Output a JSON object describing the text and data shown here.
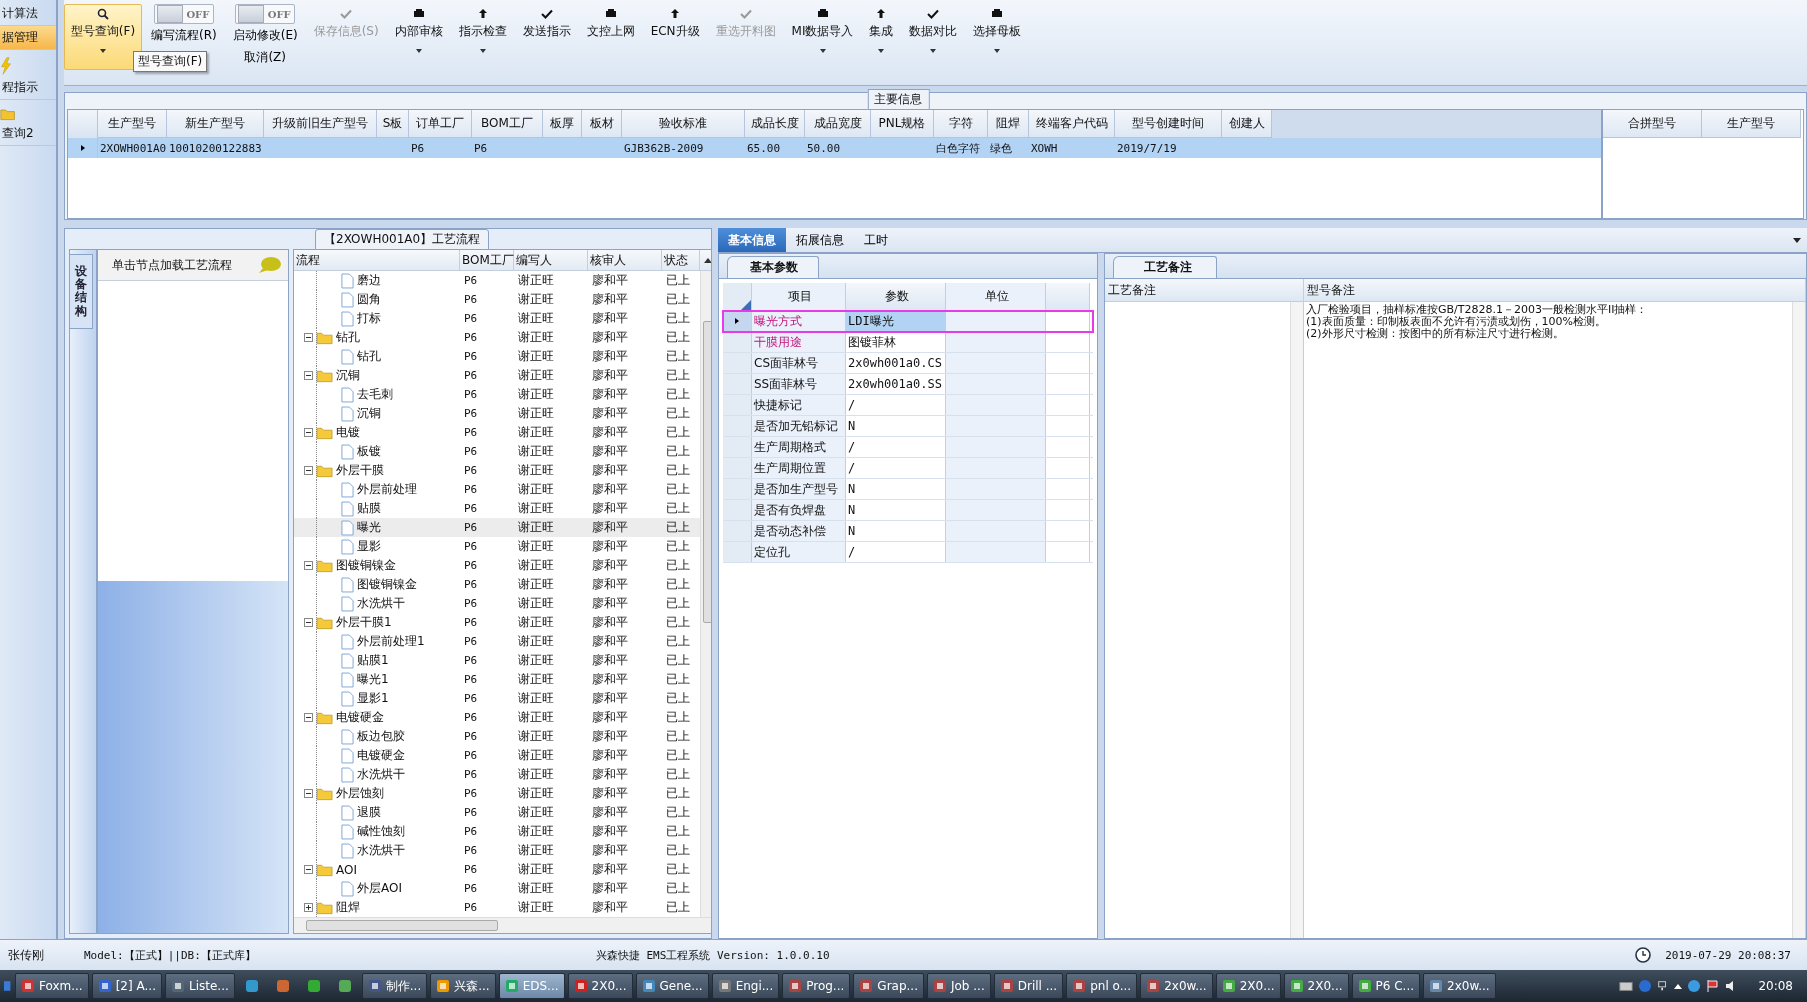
{
  "sidebar": {
    "items": [
      {
        "label": "计算法",
        "kind": "text",
        "selected": false
      },
      {
        "label": "据管理",
        "kind": "text",
        "selected": true
      },
      {
        "label": "程指示",
        "kind": "launcher",
        "selected": false
      },
      {
        "label": "查询2",
        "kind": "launcher",
        "selected": false
      }
    ]
  },
  "toolbar": {
    "buttons": [
      {
        "kind": "big",
        "label": "型号查询(F)",
        "selected": true,
        "dropdown": true
      },
      {
        "kind": "toggle",
        "switch_text": "OFF",
        "on": false,
        "label": "编写流程(R)"
      },
      {
        "kind": "toggle",
        "switch_text": "OFF",
        "on": false,
        "label": "启动修改(E)",
        "sub_label": "取消(Z)"
      },
      {
        "kind": "command",
        "label": "保存信息(S)",
        "disabled": true,
        "dropdown": false
      },
      {
        "kind": "command",
        "label": "内部审核",
        "disabled": false,
        "dropdown": true
      },
      {
        "kind": "command",
        "label": "指示检查",
        "disabled": false,
        "dropdown": true
      },
      {
        "kind": "command",
        "label": "发送指示",
        "disabled": false,
        "dropdown": false
      },
      {
        "kind": "command",
        "label": "文控上网",
        "disabled": false,
        "dropdown": false
      },
      {
        "kind": "command",
        "label": "ECN升级",
        "disabled": false,
        "dropdown": false
      },
      {
        "kind": "command",
        "label": "重选开料图",
        "disabled": true,
        "dropdown": false
      },
      {
        "kind": "command",
        "label": "MI数据导入",
        "disabled": false,
        "dropdown": true
      },
      {
        "kind": "command",
        "label": "集成",
        "disabled": false,
        "dropdown": true
      },
      {
        "kind": "command",
        "label": "数据对比",
        "disabled": false,
        "dropdown": true
      },
      {
        "kind": "command",
        "label": "选择母板",
        "disabled": false,
        "dropdown": true
      }
    ],
    "tooltip": "型号查询(F)"
  },
  "main_info": {
    "title": "主要信息",
    "columns": [
      "生产型号",
      "新生产型号",
      "升级前旧生产型号",
      "S板",
      "订单工厂",
      "BOM工厂",
      "板厚",
      "板材",
      "验收标准",
      "成品长度",
      "成品宽度",
      "PNL规格",
      "字符",
      "阻焊",
      "终端客户代码",
      "型号创建时间",
      "创建人"
    ],
    "rows": [
      {
        "selected": true,
        "cells": [
          "2XOWH001A0",
          "10010200122883",
          "",
          "",
          "P6",
          "P6",
          "",
          "",
          "GJB362B-2009",
          "65.00",
          "50.00",
          "",
          "白色字符",
          "绿色",
          "XOWH",
          "2019/7/19",
          ""
        ]
      }
    ],
    "merge_table": {
      "columns": [
        "合拼型号",
        "生产型号"
      ]
    }
  },
  "flow_panel": {
    "title": "【2XOWH001A0】工艺流程",
    "side_tab": "设备结构",
    "hint": "单击节点加载工艺流程",
    "columns": [
      "流程",
      "BOM工厂",
      "编写人",
      "核审人",
      "状态"
    ],
    "nodes": [
      {
        "kind": "folder",
        "children": [
          {
            "label": "磨边",
            "kind": "file",
            "bom": "P6",
            "writer": "谢正旺",
            "reviewer": "廖和平",
            "status": "已上",
            "selected": false
          },
          {
            "label": "圆角",
            "kind": "file",
            "bom": "P6",
            "writer": "谢正旺",
            "reviewer": "廖和平",
            "status": "已上",
            "selected": false
          },
          {
            "label": "打标",
            "kind": "file",
            "bom": "P6",
            "writer": "谢正旺",
            "reviewer": "廖和平",
            "status": "已上",
            "selected": false
          }
        ]
      },
      {
        "label": "钻孔",
        "kind": "folder",
        "expanded": true,
        "bom": "P6",
        "writer": "谢正旺",
        "reviewer": "廖和平",
        "status": "已上",
        "selected": false,
        "children": [
          {
            "label": "钻孔",
            "kind": "file",
            "bom": "P6",
            "writer": "谢正旺",
            "reviewer": "廖和平",
            "status": "已上",
            "selected": false
          }
        ]
      },
      {
        "label": "沉铜",
        "kind": "folder",
        "expanded": true,
        "bom": "P6",
        "writer": "谢正旺",
        "reviewer": "廖和平",
        "status": "已上",
        "selected": false,
        "children": [
          {
            "label": "去毛刺",
            "kind": "file",
            "bom": "P6",
            "writer": "谢正旺",
            "reviewer": "廖和平",
            "status": "已上",
            "selected": false
          },
          {
            "label": "沉铜",
            "kind": "file",
            "bom": "P6",
            "writer": "谢正旺",
            "reviewer": "廖和平",
            "status": "已上",
            "selected": false
          }
        ]
      },
      {
        "label": "电镀",
        "kind": "folder",
        "expanded": true,
        "bom": "P6",
        "writer": "谢正旺",
        "reviewer": "廖和平",
        "status": "已上",
        "selected": false,
        "children": [
          {
            "label": "板镀",
            "kind": "file",
            "bom": "P6",
            "writer": "谢正旺",
            "reviewer": "廖和平",
            "status": "已上",
            "selected": false
          }
        ]
      },
      {
        "label": "外层干膜",
        "kind": "folder",
        "expanded": true,
        "bom": "P6",
        "writer": "谢正旺",
        "reviewer": "廖和平",
        "status": "已上",
        "selected": false,
        "children": [
          {
            "label": "外层前处理",
            "kind": "file",
            "bom": "P6",
            "writer": "谢正旺",
            "reviewer": "廖和平",
            "status": "已上",
            "selected": false
          },
          {
            "label": "贴膜",
            "kind": "file",
            "bom": "P6",
            "writer": "谢正旺",
            "reviewer": "廖和平",
            "status": "已上",
            "selected": false
          },
          {
            "label": "曝光",
            "kind": "file",
            "bom": "P6",
            "writer": "谢正旺",
            "reviewer": "廖和平",
            "status": "已上",
            "selected": true
          },
          {
            "label": "显影",
            "kind": "file",
            "bom": "P6",
            "writer": "谢正旺",
            "reviewer": "廖和平",
            "status": "已上",
            "selected": false
          }
        ]
      },
      {
        "label": "图镀铜镍金",
        "kind": "folder",
        "expanded": true,
        "bom": "P6",
        "writer": "谢正旺",
        "reviewer": "廖和平",
        "status": "已上",
        "selected": false,
        "children": [
          {
            "label": "图镀铜镍金",
            "kind": "file",
            "bom": "P6",
            "writer": "谢正旺",
            "reviewer": "廖和平",
            "status": "已上",
            "selected": false
          },
          {
            "label": "水洗烘干",
            "kind": "file",
            "bom": "P6",
            "writer": "谢正旺",
            "reviewer": "廖和平",
            "status": "已上",
            "selected": false
          }
        ]
      },
      {
        "label": "外层干膜1",
        "kind": "folder",
        "expanded": true,
        "bom": "P6",
        "writer": "谢正旺",
        "reviewer": "廖和平",
        "status": "已上",
        "selected": false,
        "children": [
          {
            "label": "外层前处理1",
            "kind": "file",
            "bom": "P6",
            "writer": "谢正旺",
            "reviewer": "廖和平",
            "status": "已上",
            "selected": false
          },
          {
            "label": "贴膜1",
            "kind": "file",
            "bom": "P6",
            "writer": "谢正旺",
            "reviewer": "廖和平",
            "status": "已上",
            "selected": false
          },
          {
            "label": "曝光1",
            "kind": "file",
            "bom": "P6",
            "writer": "谢正旺",
            "reviewer": "廖和平",
            "status": "已上",
            "selected": false
          },
          {
            "label": "显影1",
            "kind": "file",
            "bom": "P6",
            "writer": "谢正旺",
            "reviewer": "廖和平",
            "status": "已上",
            "selected": false
          }
        ]
      },
      {
        "label": "电镀硬金",
        "kind": "folder",
        "expanded": true,
        "bom": "P6",
        "writer": "谢正旺",
        "reviewer": "廖和平",
        "status": "已上",
        "selected": false,
        "children": [
          {
            "label": "板边包胶",
            "kind": "file",
            "bom": "P6",
            "writer": "谢正旺",
            "reviewer": "廖和平",
            "status": "已上",
            "selected": false
          },
          {
            "label": "电镀硬金",
            "kind": "file",
            "bom": "P6",
            "writer": "谢正旺",
            "reviewer": "廖和平",
            "status": "已上",
            "selected": false
          },
          {
            "label": "水洗烘干",
            "kind": "file",
            "bom": "P6",
            "writer": "谢正旺",
            "reviewer": "廖和平",
            "status": "已上",
            "selected": false
          }
        ]
      },
      {
        "label": "外层蚀刻",
        "kind": "folder",
        "expanded": true,
        "bom": "P6",
        "writer": "谢正旺",
        "reviewer": "廖和平",
        "status": "已上",
        "selected": false,
        "children": [
          {
            "label": "退膜",
            "kind": "file",
            "bom": "P6",
            "writer": "谢正旺",
            "reviewer": "廖和平",
            "status": "已上",
            "selected": false
          },
          {
            "label": "碱性蚀刻",
            "kind": "file",
            "bom": "P6",
            "writer": "谢正旺",
            "reviewer": "廖和平",
            "status": "已上",
            "selected": false
          },
          {
            "label": "水洗烘干",
            "kind": "file",
            "bom": "P6",
            "writer": "谢正旺",
            "reviewer": "廖和平",
            "status": "已上",
            "selected": false
          }
        ]
      },
      {
        "label": "AOI",
        "kind": "folder",
        "expanded": true,
        "bom": "P6",
        "writer": "谢正旺",
        "reviewer": "廖和平",
        "status": "已上",
        "selected": false,
        "children": [
          {
            "label": "外层AOI",
            "kind": "file",
            "bom": "P6",
            "writer": "谢正旺",
            "reviewer": "廖和平",
            "status": "已上",
            "selected": false
          }
        ]
      },
      {
        "label": "阻焊",
        "kind": "folder",
        "expanded": false,
        "bom": "P6",
        "writer": "谢正旺",
        "reviewer": "廖和平",
        "status": "已上",
        "selected": false
      }
    ]
  },
  "detail_tabs": [
    {
      "label": "基本信息",
      "selected": true
    },
    {
      "label": "拓展信息",
      "selected": false
    },
    {
      "label": "工时",
      "selected": false
    }
  ],
  "params": {
    "tab": "基本参数",
    "columns": [
      "项目",
      "参数",
      "单位"
    ],
    "rows": [
      {
        "item": "曝光方式",
        "value": "LDI曝光",
        "required": true,
        "selected": true,
        "marked": true
      },
      {
        "item": "干膜用途",
        "value": "图镀菲林",
        "required": true,
        "selected": false,
        "marked": false
      },
      {
        "item": "CS面菲林号",
        "value": "2x0wh001a0.CS",
        "required": false,
        "selected": false,
        "marked": false
      },
      {
        "item": "SS面菲林号",
        "value": "2x0wh001a0.SS",
        "required": false,
        "selected": false,
        "marked": false
      },
      {
        "item": "快捷标记",
        "value": "/",
        "required": false,
        "selected": false,
        "marked": false
      },
      {
        "item": "是否加无铅标记",
        "value": "N",
        "required": false,
        "selected": false,
        "marked": false
      },
      {
        "item": "生产周期格式",
        "value": "/",
        "required": false,
        "selected": false,
        "marked": false
      },
      {
        "item": "生产周期位置",
        "value": "/",
        "required": false,
        "selected": false,
        "marked": false
      },
      {
        "item": "是否加生产型号",
        "value": "N",
        "required": false,
        "selected": false,
        "marked": false
      },
      {
        "item": "是否有负焊盘",
        "value": "N",
        "required": false,
        "selected": false,
        "marked": false
      },
      {
        "item": "是否动态补偿",
        "value": "N",
        "required": false,
        "selected": false,
        "marked": false
      },
      {
        "item": "定位孔",
        "value": "/",
        "required": false,
        "selected": false,
        "marked": false
      }
    ]
  },
  "notes": {
    "tab": "工艺备注",
    "process_heading": "工艺备注",
    "model_heading": "型号备注",
    "model_lines": [
      "入厂检验项目，抽样标准按GB/T2828.1－2003一般检测水平II抽样：",
      "(1)表面质量：印制板表面不允许有污渍或划伤，100%检测。",
      "(2)外形尺寸检测：按图中的所有标注尺寸进行检测。"
    ]
  },
  "status_bar": {
    "user": "张传刚",
    "model": "Model:【正式】||DB:【正式库】",
    "system": "兴森快捷 EMS工程系统 Version: 1.0.0.10",
    "datetime": "2019-07-29 20:08:37"
  },
  "taskbar": {
    "items": [
      {
        "kind": "app",
        "label": "Foxm...",
        "active": false
      },
      {
        "kind": "app",
        "label": "[2] A...",
        "active": false
      },
      {
        "kind": "app",
        "label": "Liste...",
        "active": false
      },
      {
        "kind": "icon",
        "active": false
      },
      {
        "kind": "icon",
        "active": false
      },
      {
        "kind": "icon",
        "active": false
      },
      {
        "kind": "icon",
        "active": false
      },
      {
        "kind": "app",
        "label": "制作...",
        "active": false
      },
      {
        "kind": "app",
        "label": "兴森...",
        "active": false
      },
      {
        "kind": "app",
        "label": "EDS...",
        "active": true
      },
      {
        "kind": "app",
        "label": "2X0...",
        "active": false
      },
      {
        "kind": "app",
        "label": "Gene...",
        "active": false
      },
      {
        "kind": "app",
        "label": "Engi...",
        "active": false
      },
      {
        "kind": "app",
        "label": "Prog...",
        "active": false
      },
      {
        "kind": "app",
        "label": "Grap...",
        "active": false
      },
      {
        "kind": "app",
        "label": "Job ...",
        "active": false
      },
      {
        "kind": "app",
        "label": "Drill ...",
        "active": false
      },
      {
        "kind": "app",
        "label": "pnl o...",
        "active": false
      },
      {
        "kind": "app",
        "label": "2x0w...",
        "active": false
      },
      {
        "kind": "app",
        "label": "2X0...",
        "active": false
      },
      {
        "kind": "app",
        "label": "2X0...",
        "active": false
      },
      {
        "kind": "app",
        "label": "P6 C...",
        "active": false
      },
      {
        "kind": "app",
        "label": "2x0w...",
        "active": false
      }
    ],
    "clock": "20:08"
  }
}
